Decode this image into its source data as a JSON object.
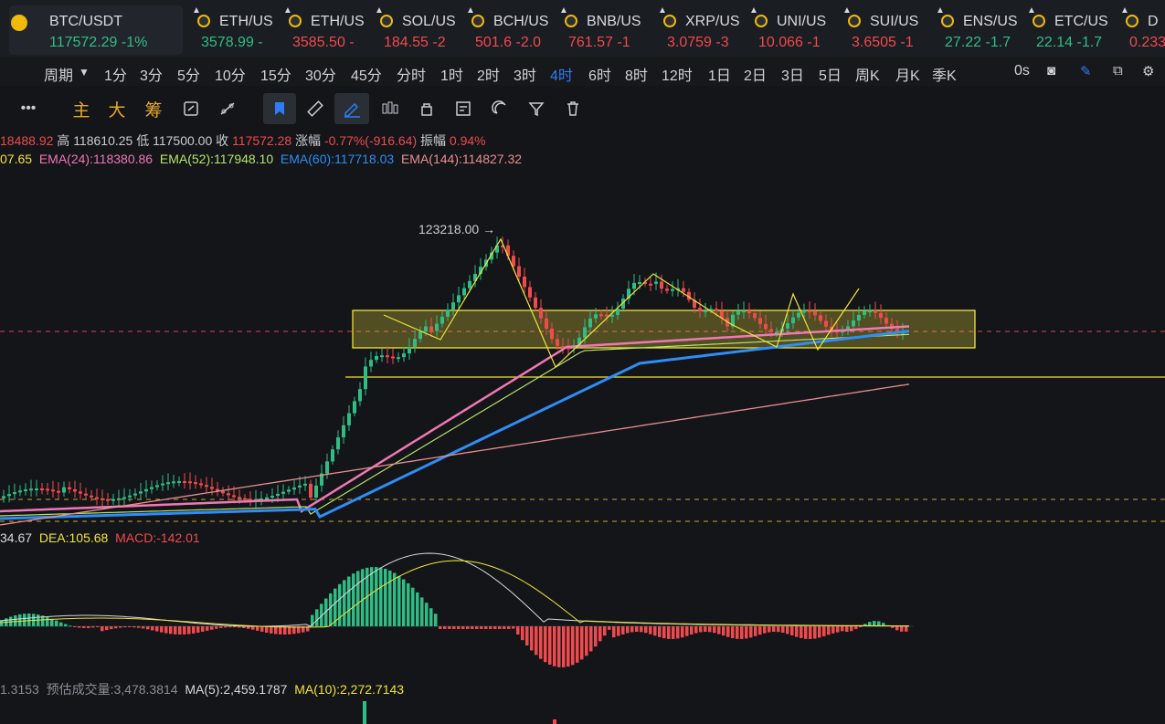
{
  "tickers": [
    {
      "symbol": "BTC/USDT",
      "price": "117572.29",
      "change": "-1%",
      "dir": "up"
    },
    {
      "symbol": "ETH/US",
      "price": "3578.99",
      "change": "-",
      "dir": "up"
    },
    {
      "symbol": "ETH/US",
      "price": "3585.50",
      "change": "-",
      "dir": "dn"
    },
    {
      "symbol": "SOL/US",
      "price": "184.55",
      "change": "-2",
      "dir": "dn"
    },
    {
      "symbol": "BCH/US",
      "price": "501.6",
      "change": "-2.0",
      "dir": "dn"
    },
    {
      "symbol": "BNB/US",
      "price": "761.57",
      "change": "-1",
      "dir": "dn"
    },
    {
      "symbol": "XRP/US",
      "price": "3.0759",
      "change": "-3",
      "dir": "dn"
    },
    {
      "symbol": "UNI/US",
      "price": "10.066",
      "change": "-1",
      "dir": "dn"
    },
    {
      "symbol": "SUI/US",
      "price": "3.6505",
      "change": "-1",
      "dir": "dn"
    },
    {
      "symbol": "ENS/US",
      "price": "27.22",
      "change": "-1.7",
      "dir": "up"
    },
    {
      "symbol": "ETC/US",
      "price": "22.14",
      "change": "-1.7",
      "dir": "up"
    },
    {
      "symbol": "D",
      "price": "0.233",
      "change": "",
      "dir": "dn"
    }
  ],
  "intervals": {
    "label": "周期",
    "items": [
      "1分",
      "3分",
      "5分",
      "10分",
      "15分",
      "30分",
      "45分",
      "分时",
      "1时",
      "2时",
      "3时",
      "4时",
      "6时",
      "8时",
      "12时",
      "1日",
      "2日",
      "3日",
      "5日",
      "周K",
      "月K",
      "季K"
    ],
    "selected": "4时",
    "countdown": "0s"
  },
  "toolbar": {
    "main": "主",
    "big": "大",
    "chip": "筹",
    "more": "•••"
  },
  "ohlc": {
    "open": "18488.92",
    "high_label": "高",
    "high": "118610.25",
    "low_label": "低",
    "low": "117500.00",
    "close_label": "收",
    "close": "117572.28",
    "chg_label": "涨幅",
    "chg": "-0.77%(-916.64)",
    "amp_label": "振幅",
    "amp": "0.94%"
  },
  "ema": {
    "e0": "07.65",
    "e24": "EMA(24):118380.86",
    "e52": "EMA(52):117948.10",
    "e60": "EMA(60):117718.03",
    "e144": "EMA(144):114827.32"
  },
  "macd": {
    "dif": "34.67",
    "dea": "DEA:105.68",
    "macd": "MACD:-142.01"
  },
  "volume": {
    "v": "1.3153",
    "est": "预估成交量:3,478.3814",
    "ma5": "MA(5):2,459.1787",
    "ma10": "MA(10):2,272.7143"
  },
  "chart_data": {
    "type": "candlestick",
    "annotations": [
      "123218.00 →"
    ],
    "series_names": [
      "EMA(24)",
      "EMA(52)",
      "EMA(60)",
      "EMA(144)"
    ],
    "colors": {
      "up": "#2fbd85",
      "down": "#f04a4d",
      "ema24": "#f078b4",
      "ema52": "#b9e36a",
      "ema60": "#2f8df5",
      "ema144": "#e88e8e",
      "box": "#f2e43a"
    }
  }
}
